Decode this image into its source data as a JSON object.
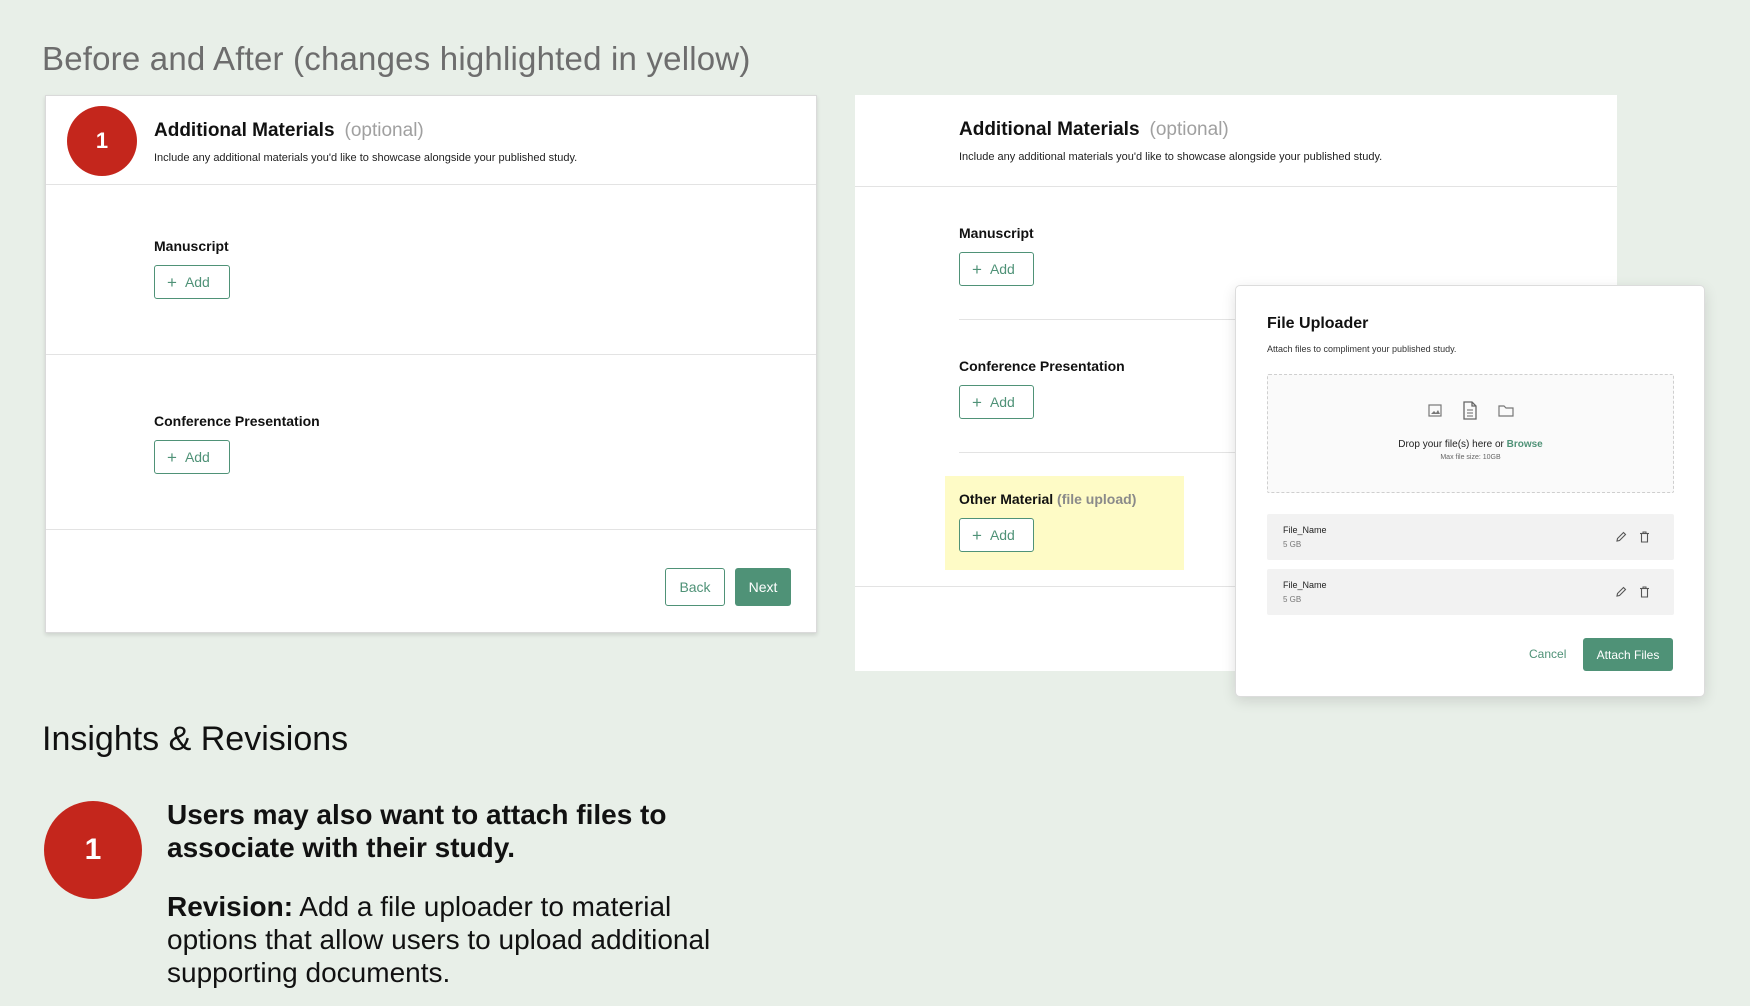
{
  "page": {
    "heading": "Before and After (changes highlighted in yellow)"
  },
  "colors": {
    "accent": "#4f9277",
    "badge": "#c4261c",
    "highlight": "#fefbc6",
    "background": "#e8efe8"
  },
  "before": {
    "badge": "1",
    "title": "Additional Materials",
    "optional": "(optional)",
    "subtitle": "Include any additional materials you'd like to showcase alongside your published study.",
    "sections": [
      {
        "label": "Manuscript",
        "add_label": "Add"
      },
      {
        "label": "Conference Presentation",
        "add_label": "Add"
      }
    ],
    "back_label": "Back",
    "next_label": "Next"
  },
  "after": {
    "title": "Additional Materials",
    "optional": "(optional)",
    "subtitle": "Include any additional materials you'd like to showcase alongside your published study.",
    "sections": [
      {
        "label": "Manuscript",
        "add_label": "Add"
      },
      {
        "label": "Conference Presentation",
        "add_label": "Add"
      }
    ],
    "other": {
      "label": "Other Material",
      "muted": "(file upload)",
      "add_label": "Add"
    }
  },
  "uploader": {
    "title": "File Uploader",
    "subtitle": "Attach files to compliment your published study.",
    "drop_text": "Drop your file(s) here or",
    "browse": "Browse",
    "max_size": "Max file size: 10GB",
    "icons": [
      "image-icon",
      "document-icon",
      "folder-icon"
    ],
    "files": [
      {
        "name": "File_Name",
        "size": "5 GB"
      },
      {
        "name": "File_Name",
        "size": "5 GB"
      }
    ],
    "cancel_label": "Cancel",
    "attach_label": "Attach Files"
  },
  "insights": {
    "title": "Insights & Revisions",
    "badge": "1",
    "headline": "Users may also want to attach files to associate with their study.",
    "revision_label": "Revision:",
    "revision_text": " Add a file uploader to material options that allow users to upload additional supporting documents."
  }
}
